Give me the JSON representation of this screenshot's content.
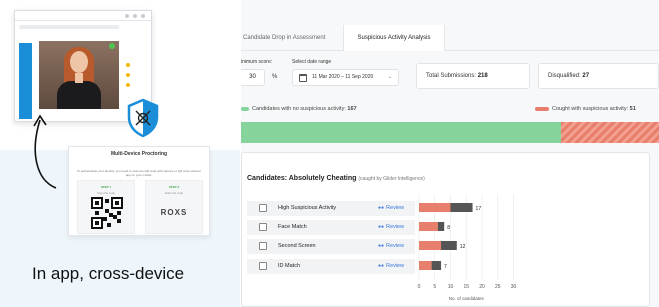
{
  "illustration": {
    "card_title": "Multi-Device Proctoring",
    "card_description": "To authenticate your identity, you need to scan the QR code with camera or QR code scanner app on your mobile.",
    "step1_label": "STEP 1",
    "step1_sub": "Scan the code",
    "step2_label": "STEP 2",
    "step2_sub": "Enter the code",
    "code": "ROXS",
    "caption": "In app, cross-device"
  },
  "dashboard": {
    "tabs": [
      {
        "label": "Candidate Drop in Assessment",
        "active": false
      },
      {
        "label": "Suspicious Activity Analysis",
        "active": true
      }
    ],
    "filters": {
      "min_score_label": "inimum score:",
      "min_score_value": "30",
      "min_score_unit": "%",
      "date_label": "Select date range",
      "date_value": "11 Mar 2020 – 11 Sep 2020"
    },
    "stats": {
      "total_label": "Total Submissions:",
      "total_value": "218",
      "disqualified_label": "Disqualified:",
      "disqualified_value": "27"
    },
    "legend": {
      "clean_label": "Candidates with no suspicious activity:",
      "clean_value": "167",
      "caught_label": "Cought with suspicious activity:",
      "caught_value": "51",
      "clean_color": "#86d39b",
      "caught_color": "#e87f6c"
    },
    "split": {
      "clean": 167,
      "caught": 51
    },
    "cheating": {
      "title": "Candidates: Absolutely Cheating",
      "subtitle": "(caught by Glider Intelligence)",
      "review_label": "Review",
      "rows": [
        {
          "label": "High Suspicious Activity"
        },
        {
          "label": "Face Match"
        },
        {
          "label": "Second Screen"
        },
        {
          "label": "ID Match"
        }
      ]
    }
  },
  "chart_data": {
    "type": "bar",
    "orientation": "horizontal",
    "stacked": true,
    "categories": [
      "High Suspicious Activity",
      "Face Match",
      "Second Screen",
      "ID Match"
    ],
    "series": [
      {
        "values": [
          10,
          6,
          7,
          4
        ],
        "color": "#e87f6c"
      },
      {
        "values": [
          7,
          2,
          5,
          3
        ],
        "color": "#555555"
      }
    ],
    "totals": [
      17,
      8,
      12,
      7
    ],
    "xticks": [
      0,
      5,
      10,
      15,
      20,
      25,
      30
    ],
    "xlim": [
      0,
      30
    ],
    "xlabel": "No. of candidates",
    "grid": true
  }
}
